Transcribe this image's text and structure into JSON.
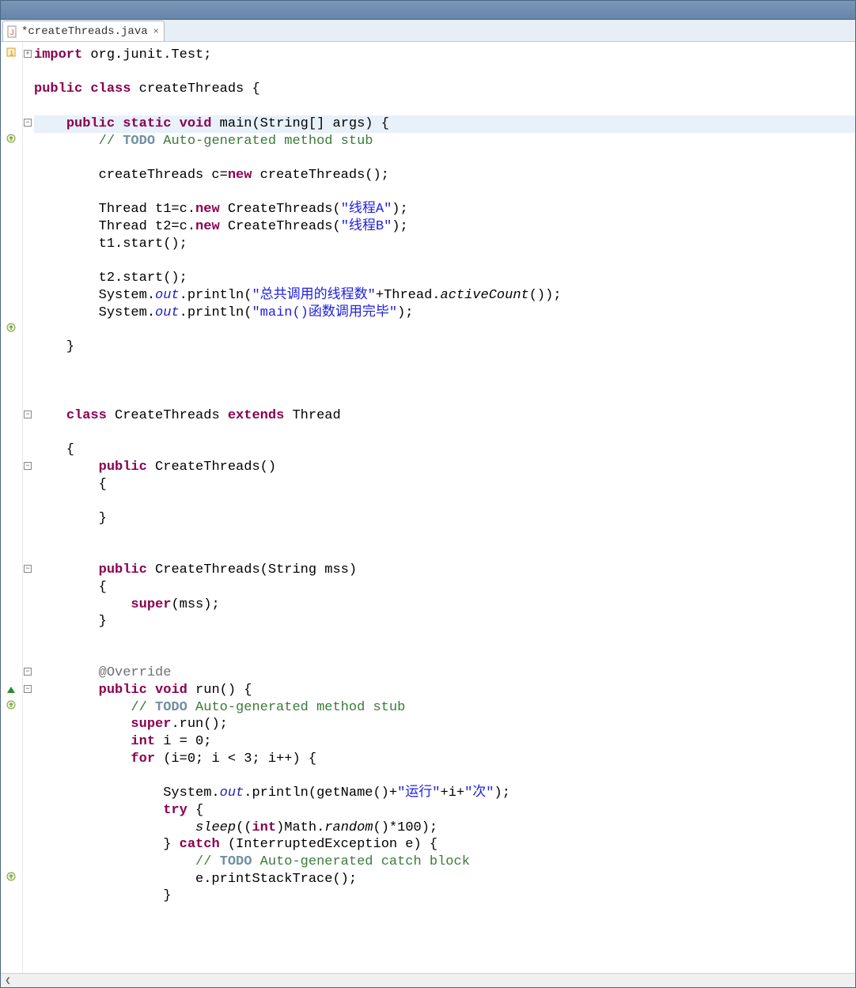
{
  "tab": {
    "filename": "*createThreads.java"
  },
  "code": {
    "lines": [
      {
        "indent": 0,
        "segs": [
          {
            "t": "import",
            "c": "kw"
          },
          {
            "t": " org.junit.Test;",
            "c": ""
          }
        ]
      },
      {
        "blank": true
      },
      {
        "indent": 0,
        "segs": [
          {
            "t": "public",
            "c": "kw"
          },
          {
            "t": " ",
            "c": ""
          },
          {
            "t": "class",
            "c": "kw"
          },
          {
            "t": " createThreads {",
            "c": ""
          }
        ]
      },
      {
        "blank": true
      },
      {
        "indent": 1,
        "hl": true,
        "segs": [
          {
            "t": "public",
            "c": "kw"
          },
          {
            "t": " ",
            "c": ""
          },
          {
            "t": "static",
            "c": "kw"
          },
          {
            "t": " ",
            "c": ""
          },
          {
            "t": "void",
            "c": "kw"
          },
          {
            "t": " main(String[] args) {",
            "c": ""
          }
        ]
      },
      {
        "indent": 2,
        "segs": [
          {
            "t": "// ",
            "c": "cm"
          },
          {
            "t": "TODO",
            "c": "todo"
          },
          {
            "t": " Auto-generated method stub",
            "c": "cm"
          }
        ]
      },
      {
        "blank": true
      },
      {
        "indent": 2,
        "segs": [
          {
            "t": "createThreads c=",
            "c": ""
          },
          {
            "t": "new",
            "c": "kw"
          },
          {
            "t": " createThreads();",
            "c": ""
          }
        ]
      },
      {
        "blank": true
      },
      {
        "indent": 2,
        "segs": [
          {
            "t": "Thread t1=c.",
            "c": ""
          },
          {
            "t": "new",
            "c": "kw"
          },
          {
            "t": " CreateThreads(",
            "c": ""
          },
          {
            "t": "\"线程A\"",
            "c": "st"
          },
          {
            "t": ");",
            "c": ""
          }
        ]
      },
      {
        "indent": 2,
        "segs": [
          {
            "t": "Thread t2=c.",
            "c": ""
          },
          {
            "t": "new",
            "c": "kw"
          },
          {
            "t": " CreateThreads(",
            "c": ""
          },
          {
            "t": "\"线程B\"",
            "c": "st"
          },
          {
            "t": ");",
            "c": ""
          }
        ]
      },
      {
        "indent": 2,
        "segs": [
          {
            "t": "t1.start();",
            "c": ""
          }
        ]
      },
      {
        "blank": true
      },
      {
        "indent": 2,
        "segs": [
          {
            "t": "t2.start();",
            "c": ""
          }
        ]
      },
      {
        "indent": 2,
        "segs": [
          {
            "t": "System.",
            "c": ""
          },
          {
            "t": "out",
            "c": "sf"
          },
          {
            "t": ".println(",
            "c": ""
          },
          {
            "t": "\"总共调用的线程数\"",
            "c": "st"
          },
          {
            "t": "+Thread.",
            "c": ""
          },
          {
            "t": "activeCount",
            "c": "si"
          },
          {
            "t": "());",
            "c": ""
          }
        ]
      },
      {
        "indent": 2,
        "segs": [
          {
            "t": "System.",
            "c": ""
          },
          {
            "t": "out",
            "c": "sf"
          },
          {
            "t": ".println(",
            "c": ""
          },
          {
            "t": "\"main()函数调用完毕\"",
            "c": "st"
          },
          {
            "t": ");",
            "c": ""
          }
        ]
      },
      {
        "blank": true
      },
      {
        "indent": 1,
        "segs": [
          {
            "t": "}",
            "c": ""
          }
        ]
      },
      {
        "blank": true
      },
      {
        "blank": true
      },
      {
        "blank": true
      },
      {
        "indent": 1,
        "segs": [
          {
            "t": "class",
            "c": "kw"
          },
          {
            "t": " CreateThreads ",
            "c": ""
          },
          {
            "t": "extends",
            "c": "kw"
          },
          {
            "t": " Thread",
            "c": ""
          }
        ]
      },
      {
        "blank": true
      },
      {
        "indent": 1,
        "segs": [
          {
            "t": "{",
            "c": ""
          }
        ]
      },
      {
        "indent": 2,
        "segs": [
          {
            "t": "public",
            "c": "kw"
          },
          {
            "t": " CreateThreads()",
            "c": ""
          }
        ]
      },
      {
        "indent": 2,
        "segs": [
          {
            "t": "{",
            "c": ""
          }
        ]
      },
      {
        "blank": true
      },
      {
        "indent": 2,
        "segs": [
          {
            "t": "}",
            "c": ""
          }
        ]
      },
      {
        "blank": true
      },
      {
        "blank": true
      },
      {
        "indent": 2,
        "segs": [
          {
            "t": "public",
            "c": "kw"
          },
          {
            "t": " CreateThreads(String mss)",
            "c": ""
          }
        ]
      },
      {
        "indent": 2,
        "segs": [
          {
            "t": "{",
            "c": ""
          }
        ]
      },
      {
        "indent": 3,
        "segs": [
          {
            "t": "super",
            "c": "kw"
          },
          {
            "t": "(mss);",
            "c": ""
          }
        ]
      },
      {
        "indent": 2,
        "segs": [
          {
            "t": "}",
            "c": ""
          }
        ]
      },
      {
        "blank": true
      },
      {
        "blank": true
      },
      {
        "indent": 2,
        "segs": [
          {
            "t": "@Override",
            "c": "ann"
          }
        ]
      },
      {
        "indent": 2,
        "segs": [
          {
            "t": "public",
            "c": "kw"
          },
          {
            "t": " ",
            "c": ""
          },
          {
            "t": "void",
            "c": "kw"
          },
          {
            "t": " run() {",
            "c": ""
          }
        ]
      },
      {
        "indent": 3,
        "segs": [
          {
            "t": "// ",
            "c": "cm"
          },
          {
            "t": "TODO",
            "c": "todo"
          },
          {
            "t": " Auto-generated method stub",
            "c": "cm"
          }
        ]
      },
      {
        "indent": 3,
        "segs": [
          {
            "t": "super",
            "c": "kw"
          },
          {
            "t": ".run();",
            "c": ""
          }
        ]
      },
      {
        "indent": 3,
        "segs": [
          {
            "t": "int",
            "c": "kw"
          },
          {
            "t": " i = 0;",
            "c": ""
          }
        ]
      },
      {
        "indent": 3,
        "segs": [
          {
            "t": "for",
            "c": "kw"
          },
          {
            "t": " (i=0; i < 3; i++) {",
            "c": ""
          }
        ]
      },
      {
        "blank": true
      },
      {
        "indent": 4,
        "segs": [
          {
            "t": "System.",
            "c": ""
          },
          {
            "t": "out",
            "c": "sf"
          },
          {
            "t": ".println(getName()+",
            "c": ""
          },
          {
            "t": "\"运行\"",
            "c": "st"
          },
          {
            "t": "+i+",
            "c": ""
          },
          {
            "t": "\"次\"",
            "c": "st"
          },
          {
            "t": ");",
            "c": ""
          }
        ]
      },
      {
        "indent": 4,
        "segs": [
          {
            "t": "try",
            "c": "kw"
          },
          {
            "t": " {",
            "c": ""
          }
        ]
      },
      {
        "indent": 5,
        "segs": [
          {
            "t": "sleep",
            "c": "si"
          },
          {
            "t": "((",
            "c": ""
          },
          {
            "t": "int",
            "c": "kw"
          },
          {
            "t": ")Math.",
            "c": ""
          },
          {
            "t": "random",
            "c": "si"
          },
          {
            "t": "()*100);",
            "c": ""
          }
        ]
      },
      {
        "indent": 4,
        "segs": [
          {
            "t": "} ",
            "c": ""
          },
          {
            "t": "catch",
            "c": "kw"
          },
          {
            "t": " (InterruptedException e) {",
            "c": ""
          }
        ]
      },
      {
        "indent": 5,
        "segs": [
          {
            "t": "// ",
            "c": "cm"
          },
          {
            "t": "TODO",
            "c": "todo"
          },
          {
            "t": " Auto-generated catch block",
            "c": "cm"
          }
        ]
      },
      {
        "indent": 5,
        "segs": [
          {
            "t": "e.printStackTrace();",
            "c": ""
          }
        ]
      },
      {
        "indent": 4,
        "segs": [
          {
            "t": "}",
            "c": ""
          }
        ]
      }
    ]
  },
  "gutter": {
    "importMark": 0,
    "overrideMarks": [
      5,
      16,
      38,
      48
    ],
    "triangleMark": 37
  },
  "foldMarks": {
    "minus": [
      4,
      21,
      24,
      30,
      36,
      37
    ],
    "plus": [
      0
    ]
  }
}
